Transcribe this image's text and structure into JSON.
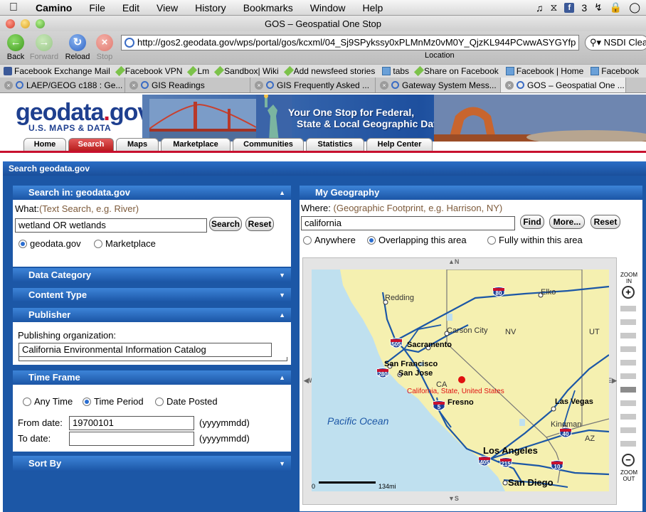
{
  "menubar": {
    "app": "Camino",
    "items": [
      "File",
      "Edit",
      "View",
      "History",
      "Bookmarks",
      "Window",
      "Help"
    ],
    "fb_count": "3"
  },
  "window": {
    "title": "GOS – Geospatial One Stop"
  },
  "toolbar": {
    "back": "Back",
    "forward": "Forward",
    "reload": "Reload",
    "stop": "Stop",
    "url": "http://gos2.geodata.gov/wps/portal/gos/kcxml/04_Sj9SPykssy0xPLMnMz0vM0Y_QjzKL944PCwwASYGYfp",
    "location_label": "Location",
    "search_value": "NSDI Clea"
  },
  "bookmarks": [
    {
      "label": "Facebook Exchange Mail",
      "icon": "facebook"
    },
    {
      "label": "Facebook VPN",
      "icon": "pin"
    },
    {
      "label": "Lm",
      "icon": "pin"
    },
    {
      "label": "Sandbox| Wiki",
      "icon": "pin"
    },
    {
      "label": "Add newsfeed stories",
      "icon": "pin"
    },
    {
      "label": "tabs",
      "icon": "folder"
    },
    {
      "label": "Share on Facebook",
      "icon": "pin"
    },
    {
      "label": "Facebook | Home",
      "icon": "folder"
    },
    {
      "label": "Facebook",
      "icon": "folder"
    }
  ],
  "tabs": [
    {
      "label": "LAEP/GEOG c188 : Ge..."
    },
    {
      "label": "GIS Readings"
    },
    {
      "label": "GIS Frequently Asked ..."
    },
    {
      "label": "Gateway System Mess..."
    },
    {
      "label": "GOS – Geospatial One ..."
    }
  ],
  "site": {
    "logo_main": "geodata",
    "logo_dot": ".",
    "logo_tld": "gov",
    "logo_sub": "U.S. MAPS & DATA",
    "tagline_1": "Your One Stop for Federal,",
    "tagline_2": "State & Local Geographic Data",
    "nav": [
      "Home",
      "Search",
      "Maps",
      "Marketplace",
      "Communities",
      "Statistics",
      "Help Center"
    ],
    "section_title": "Search geodata.gov"
  },
  "search_panel": {
    "title": "Search in: geodata.gov",
    "what_label": "What:",
    "what_hint": "(Text Search, e.g. River)",
    "query": "wetland OR wetlands",
    "search_btn": "Search",
    "reset_btn": "Reset",
    "scope_1": "geodata.gov",
    "scope_2": "Marketplace"
  },
  "data_category": {
    "title": "Data Category"
  },
  "content_type": {
    "title": "Content Type"
  },
  "publisher": {
    "title": "Publisher",
    "org_label": "Publishing organization:",
    "org_value": "California Environmental Information Catalog"
  },
  "time_frame": {
    "title": "Time Frame",
    "opt_any": "Any Time",
    "opt_period": "Time Period",
    "opt_posted": "Date Posted",
    "from_label": "From date:",
    "from_value": "19700101",
    "to_label": "To date:",
    "to_value": "",
    "format": "(yyyymmdd)"
  },
  "sort_by": {
    "title": "Sort By"
  },
  "geography": {
    "title": "My Geography",
    "where_label": "Where:",
    "where_hint": "(Geographic Footprint, e.g. Harrison, NY)",
    "where_value": "california",
    "find_btn": "Find",
    "more_btn": "More...",
    "reset_btn": "Reset",
    "opt_anywhere": "Anywhere",
    "opt_overlap": "Overlapping this area",
    "opt_within": "Fully within this area",
    "zoom_in": "ZOOM IN",
    "zoom_out": "ZOOM OUT",
    "compass_n": "N",
    "compass_s": "S",
    "compass_e": "E",
    "compass_w": "W"
  },
  "map": {
    "ocean": "Pacific Ocean",
    "marker": "California, State, United States",
    "scale_start": "0",
    "scale_end": "134mi",
    "states": [
      "NV",
      "UT",
      "CA",
      "AZ"
    ],
    "cities": [
      "Redding",
      "Elko",
      "Carson City",
      "Sacramento",
      "San Francisco",
      "San Jose",
      "Fresno",
      "Las Vegas",
      "Kingman",
      "Los Angeles",
      "San Diego"
    ],
    "shields": [
      "80",
      "505",
      "280",
      "5",
      "15",
      "40",
      "405",
      "215",
      "10"
    ]
  }
}
